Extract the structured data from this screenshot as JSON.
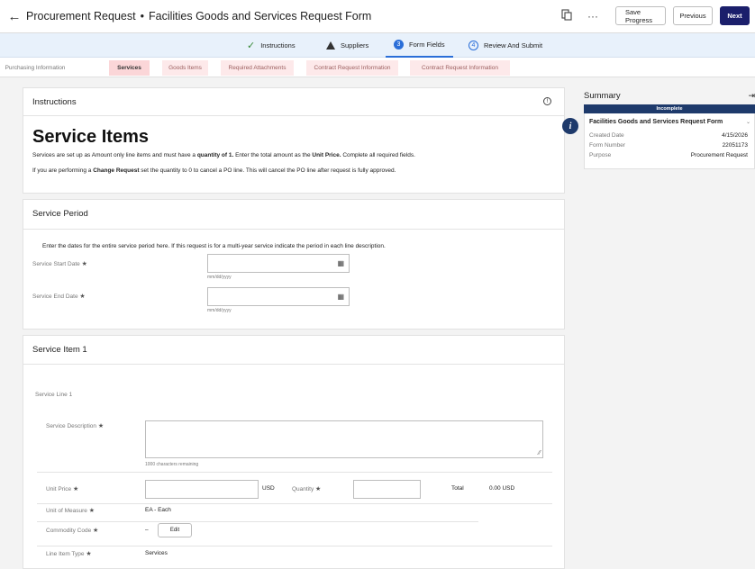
{
  "header": {
    "title": "Procurement Request",
    "subtitle": "Facilities Goods and Services Request Form",
    "more": "···",
    "save_progress": "Save Progress",
    "previous": "Previous",
    "next": "Next"
  },
  "steps": [
    {
      "label": "Instructions",
      "icon": "check-icon",
      "status": "complete"
    },
    {
      "label": "Suppliers",
      "icon": "warning-icon",
      "status": "warning"
    },
    {
      "label": "Form Fields",
      "number": "3",
      "status": "current"
    },
    {
      "label": "Review And Submit",
      "number": "4",
      "status": "pending"
    }
  ],
  "tabs": [
    {
      "label": "Purchasing Information"
    },
    {
      "label": "Services"
    },
    {
      "label": "Goods Items"
    },
    {
      "label": "Required Attachments"
    },
    {
      "label": "Contract Request Information"
    },
    {
      "label": "Contract Request Information"
    }
  ],
  "instructions": {
    "heading": "Instructions",
    "title": "Service Items",
    "line1_a": "Services are set up as Amount only line items and must have a ",
    "line1_b": "quantity of 1.",
    "line1_c": " Enter the total amount as the ",
    "line1_d": "Unit Price.",
    "line1_e": " Complete all required fields.",
    "line2_a": "If you are performing a ",
    "line2_b": "Change Request",
    "line2_c": " set the quantity to 0 to cancel a PO line.  This will cancel the PO line after request is fully approved."
  },
  "service_period": {
    "heading": "Service Period",
    "note": "Enter the dates for the entire service period here.  If this request is for a multi-year service indicate the period in each line description.",
    "start_label": "Service Start Date",
    "end_label": "Service End Date",
    "date_hint": "mm/dd/yyyy"
  },
  "service_item": {
    "heading": "Service Item 1",
    "line_label": "Service Line 1",
    "description_label": "Service Description",
    "chars_remaining": "1000 characters remaining",
    "unit_price_label": "Unit Price",
    "currency": "USD",
    "quantity_label": "Quantity",
    "total_label": "Total",
    "total_value": "0.00 USD",
    "uom_label": "Unit of Measure",
    "uom_value": "EA - Each",
    "commodity_label": "Commodity Code",
    "commodity_value": "–",
    "edit_label": "Edit",
    "line_type_label": "Line Item Type",
    "line_type_value": "Services"
  },
  "summary": {
    "heading": "Summary",
    "status": "Incomplete",
    "form_name": "Facilities Goods and Services Request Form",
    "rows": [
      {
        "label": "Created Date",
        "value": "4/15/2026"
      },
      {
        "label": "Form Number",
        "value": "22051173"
      },
      {
        "label": "Purpose",
        "value": "Procurement Request"
      }
    ]
  }
}
